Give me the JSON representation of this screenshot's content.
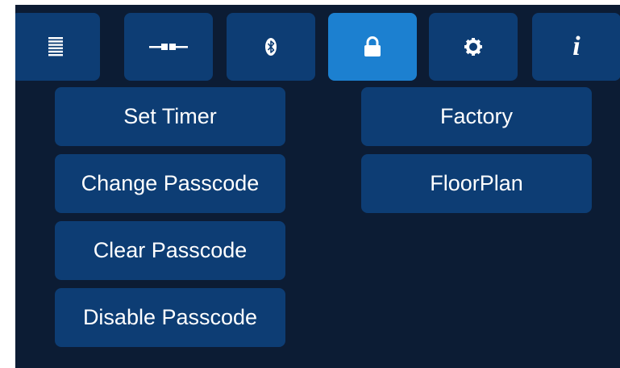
{
  "tabs": [
    {
      "id": "list",
      "icon": "list-icon"
    },
    {
      "id": "connection",
      "icon": "connector-icon"
    },
    {
      "id": "bluetooth",
      "icon": "bluetooth-icon"
    },
    {
      "id": "security",
      "icon": "lock-icon",
      "active": true
    },
    {
      "id": "settings",
      "icon": "gear-icon"
    },
    {
      "id": "info",
      "icon": "info-icon",
      "glyph": "i"
    }
  ],
  "buttons": {
    "set_timer": "Set Timer",
    "change_passcode": "Change Passcode",
    "clear_passcode": "Clear Passcode",
    "disable_passcode": "Disable Passcode",
    "factory": "Factory",
    "floorplan": "FloorPlan"
  },
  "colors": {
    "background": "#0c1c34",
    "button": "#0d3d74",
    "active_tab": "#1c80d0",
    "text": "#ffffff"
  }
}
